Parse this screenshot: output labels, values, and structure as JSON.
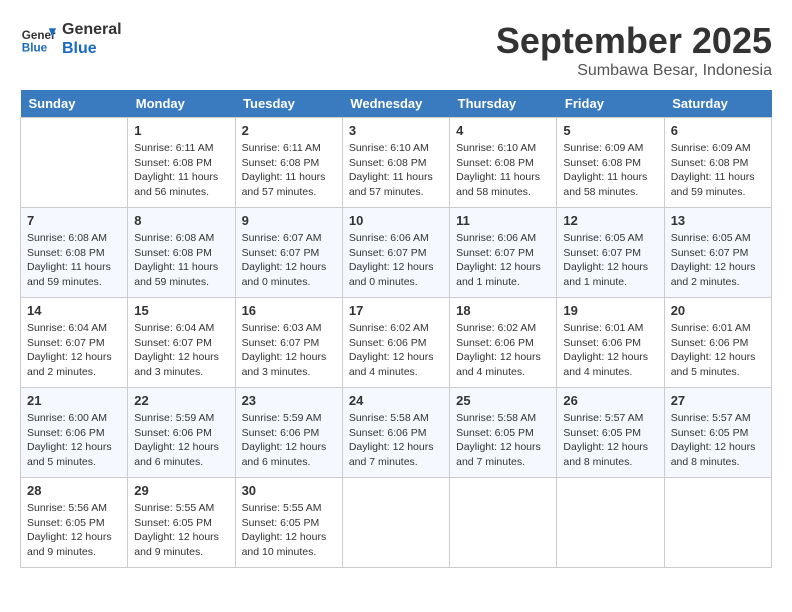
{
  "header": {
    "logo_line1": "General",
    "logo_line2": "Blue",
    "month": "September 2025",
    "location": "Sumbawa Besar, Indonesia"
  },
  "weekdays": [
    "Sunday",
    "Monday",
    "Tuesday",
    "Wednesday",
    "Thursday",
    "Friday",
    "Saturday"
  ],
  "weeks": [
    [
      {
        "day": "",
        "info": ""
      },
      {
        "day": "1",
        "info": "Sunrise: 6:11 AM\nSunset: 6:08 PM\nDaylight: 11 hours\nand 56 minutes."
      },
      {
        "day": "2",
        "info": "Sunrise: 6:11 AM\nSunset: 6:08 PM\nDaylight: 11 hours\nand 57 minutes."
      },
      {
        "day": "3",
        "info": "Sunrise: 6:10 AM\nSunset: 6:08 PM\nDaylight: 11 hours\nand 57 minutes."
      },
      {
        "day": "4",
        "info": "Sunrise: 6:10 AM\nSunset: 6:08 PM\nDaylight: 11 hours\nand 58 minutes."
      },
      {
        "day": "5",
        "info": "Sunrise: 6:09 AM\nSunset: 6:08 PM\nDaylight: 11 hours\nand 58 minutes."
      },
      {
        "day": "6",
        "info": "Sunrise: 6:09 AM\nSunset: 6:08 PM\nDaylight: 11 hours\nand 59 minutes."
      }
    ],
    [
      {
        "day": "7",
        "info": "Sunrise: 6:08 AM\nSunset: 6:08 PM\nDaylight: 11 hours\nand 59 minutes."
      },
      {
        "day": "8",
        "info": "Sunrise: 6:08 AM\nSunset: 6:08 PM\nDaylight: 11 hours\nand 59 minutes."
      },
      {
        "day": "9",
        "info": "Sunrise: 6:07 AM\nSunset: 6:07 PM\nDaylight: 12 hours\nand 0 minutes."
      },
      {
        "day": "10",
        "info": "Sunrise: 6:06 AM\nSunset: 6:07 PM\nDaylight: 12 hours\nand 0 minutes."
      },
      {
        "day": "11",
        "info": "Sunrise: 6:06 AM\nSunset: 6:07 PM\nDaylight: 12 hours\nand 1 minute."
      },
      {
        "day": "12",
        "info": "Sunrise: 6:05 AM\nSunset: 6:07 PM\nDaylight: 12 hours\nand 1 minute."
      },
      {
        "day": "13",
        "info": "Sunrise: 6:05 AM\nSunset: 6:07 PM\nDaylight: 12 hours\nand 2 minutes."
      }
    ],
    [
      {
        "day": "14",
        "info": "Sunrise: 6:04 AM\nSunset: 6:07 PM\nDaylight: 12 hours\nand 2 minutes."
      },
      {
        "day": "15",
        "info": "Sunrise: 6:04 AM\nSunset: 6:07 PM\nDaylight: 12 hours\nand 3 minutes."
      },
      {
        "day": "16",
        "info": "Sunrise: 6:03 AM\nSunset: 6:07 PM\nDaylight: 12 hours\nand 3 minutes."
      },
      {
        "day": "17",
        "info": "Sunrise: 6:02 AM\nSunset: 6:06 PM\nDaylight: 12 hours\nand 4 minutes."
      },
      {
        "day": "18",
        "info": "Sunrise: 6:02 AM\nSunset: 6:06 PM\nDaylight: 12 hours\nand 4 minutes."
      },
      {
        "day": "19",
        "info": "Sunrise: 6:01 AM\nSunset: 6:06 PM\nDaylight: 12 hours\nand 4 minutes."
      },
      {
        "day": "20",
        "info": "Sunrise: 6:01 AM\nSunset: 6:06 PM\nDaylight: 12 hours\nand 5 minutes."
      }
    ],
    [
      {
        "day": "21",
        "info": "Sunrise: 6:00 AM\nSunset: 6:06 PM\nDaylight: 12 hours\nand 5 minutes."
      },
      {
        "day": "22",
        "info": "Sunrise: 5:59 AM\nSunset: 6:06 PM\nDaylight: 12 hours\nand 6 minutes."
      },
      {
        "day": "23",
        "info": "Sunrise: 5:59 AM\nSunset: 6:06 PM\nDaylight: 12 hours\nand 6 minutes."
      },
      {
        "day": "24",
        "info": "Sunrise: 5:58 AM\nSunset: 6:06 PM\nDaylight: 12 hours\nand 7 minutes."
      },
      {
        "day": "25",
        "info": "Sunrise: 5:58 AM\nSunset: 6:05 PM\nDaylight: 12 hours\nand 7 minutes."
      },
      {
        "day": "26",
        "info": "Sunrise: 5:57 AM\nSunset: 6:05 PM\nDaylight: 12 hours\nand 8 minutes."
      },
      {
        "day": "27",
        "info": "Sunrise: 5:57 AM\nSunset: 6:05 PM\nDaylight: 12 hours\nand 8 minutes."
      }
    ],
    [
      {
        "day": "28",
        "info": "Sunrise: 5:56 AM\nSunset: 6:05 PM\nDaylight: 12 hours\nand 9 minutes."
      },
      {
        "day": "29",
        "info": "Sunrise: 5:55 AM\nSunset: 6:05 PM\nDaylight: 12 hours\nand 9 minutes."
      },
      {
        "day": "30",
        "info": "Sunrise: 5:55 AM\nSunset: 6:05 PM\nDaylight: 12 hours\nand 10 minutes."
      },
      {
        "day": "",
        "info": ""
      },
      {
        "day": "",
        "info": ""
      },
      {
        "day": "",
        "info": ""
      },
      {
        "day": "",
        "info": ""
      }
    ]
  ]
}
